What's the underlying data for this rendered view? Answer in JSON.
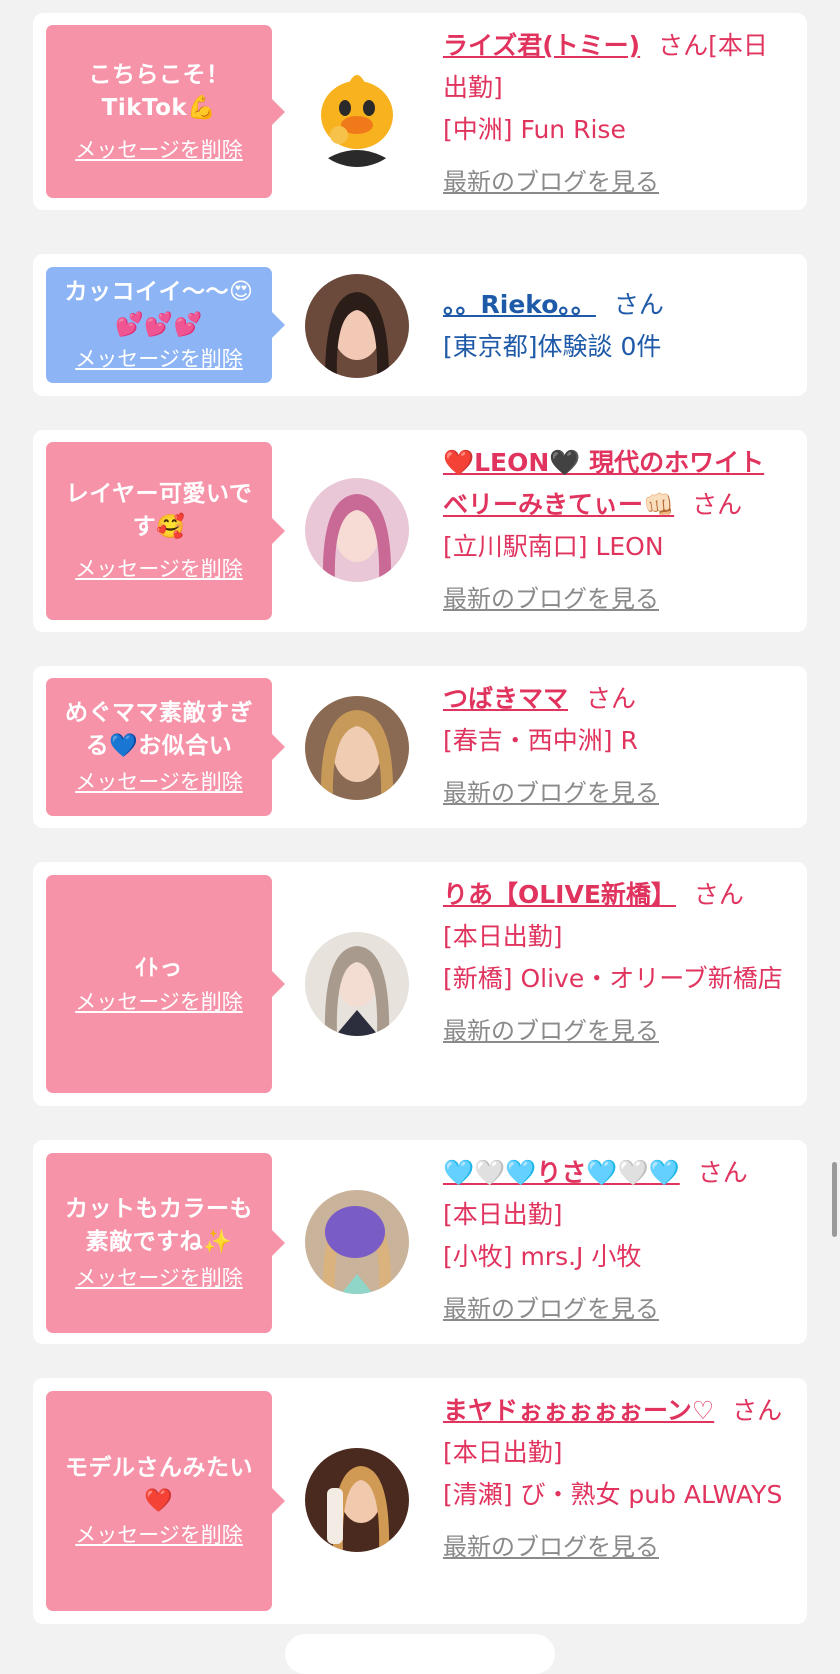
{
  "delete_label": "メッセージを削除",
  "blog_label": "最新のブログを見る",
  "san_label": "さん",
  "cards": [
    {
      "message": "こちらこそ！TikTok💪",
      "bubble_color": "pink",
      "name": "ライズ君(トミー)",
      "name_suffix": "[本日出勤]",
      "details": [
        "[中洲] Fun Rise"
      ],
      "show_blog": true,
      "avatar_icon": "duck-mascot-icon"
    },
    {
      "message": "カッコイイ〜〜😍💕💕💕",
      "bubble_color": "blue",
      "name": "。。Rieko。。",
      "name_suffix": "",
      "details": [
        "[東京都]体験談 0件"
      ],
      "show_blog": false,
      "avatar_icon": "profile-photo-icon"
    },
    {
      "message": "レイヤー可愛いです🥰",
      "bubble_color": "pink",
      "name": "❤️LEON🖤 現代のホワイトベリーみきてぃー👊🏻",
      "name_suffix": "",
      "details": [
        "[立川駅南口] LEON"
      ],
      "show_blog": true,
      "avatar_icon": "profile-photo-icon"
    },
    {
      "message": "めぐママ素敵すぎる💙お似合い",
      "bubble_color": "pink",
      "name": "つばきママ",
      "name_suffix": "",
      "details": [
        "[春吉・西中洲] R"
      ],
      "show_blog": true,
      "avatar_icon": "profile-photo-icon"
    },
    {
      "message": "ｲﾄっ",
      "bubble_color": "pink",
      "name": "りあ【OLIVE新橋】",
      "name_suffix": "",
      "details": [
        "[本日出勤]",
        "[新橋] Olive・オリーブ新橋店"
      ],
      "show_blog": true,
      "avatar_icon": "profile-photo-icon"
    },
    {
      "message": "カットもカラーも素敵ですね✨",
      "bubble_color": "pink",
      "name": "🩵🤍🩵りさ🩵🤍🩵",
      "name_suffix": "",
      "details": [
        "[本日出勤]",
        "[小牧] mrs.J 小牧"
      ],
      "show_blog": true,
      "avatar_icon": "profile-photo-icon"
    },
    {
      "message": "モデルさんみたい❤️",
      "bubble_color": "pink",
      "name": "まヤドぉぉぉぉぉーン♡",
      "name_suffix": "[本日出勤]",
      "details": [
        "[清瀬] び・熟女 pub ALWAYS"
      ],
      "show_blog": true,
      "avatar_icon": "profile-photo-icon"
    }
  ]
}
